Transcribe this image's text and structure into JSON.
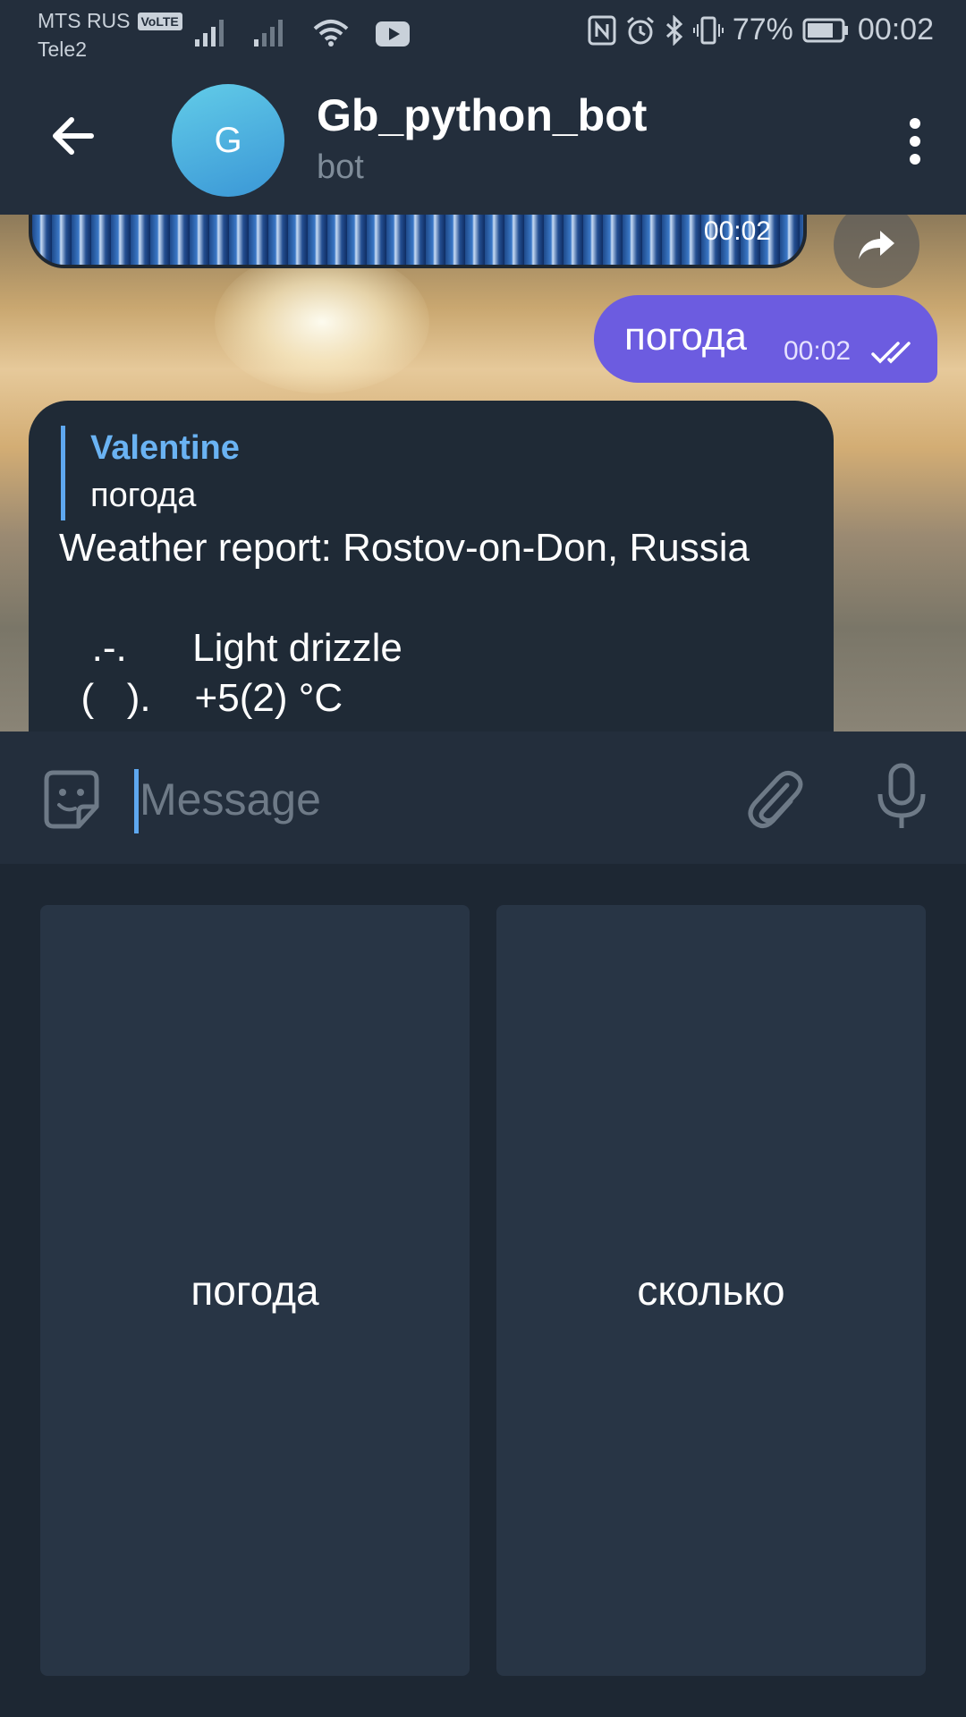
{
  "status_bar": {
    "carrier_primary": "MTS RUS",
    "volte": "VoLTE",
    "carrier_secondary": "Tele2",
    "battery_percent": "77%",
    "time": "00:02"
  },
  "header": {
    "avatar_letter": "G",
    "title": "Gb_python_bot",
    "subtitle": "bot"
  },
  "messages": {
    "image_time": "00:02",
    "outgoing": {
      "text": "погода",
      "time": "00:02"
    },
    "incoming": {
      "reply_author": "Valentine",
      "reply_text": "погода",
      "line1": "Weather report: Rostov-on-Don, Russia",
      "line2": "   .-.      Light drizzle",
      "line3": "  (   ).    +5(2) °C"
    }
  },
  "input": {
    "placeholder": "Message"
  },
  "keyboard": {
    "buttons": [
      {
        "label": "погода"
      },
      {
        "label": "сколько"
      }
    ]
  },
  "colors": {
    "header_bg": "#232e3c",
    "outgoing_bubble": "#6c5ce0",
    "incoming_bubble": "#1f2a36",
    "accent": "#6ab3f3",
    "keyboard_button": "#283545"
  }
}
